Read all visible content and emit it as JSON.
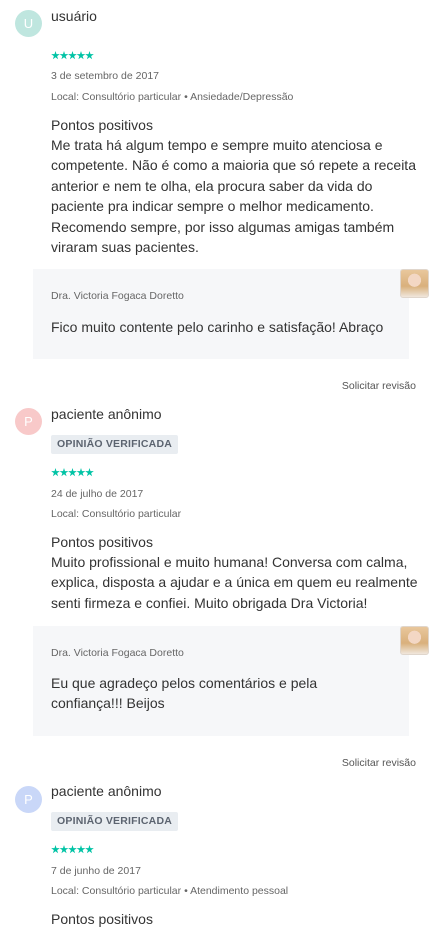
{
  "reviews": [
    {
      "avatar_letter": "U",
      "avatar_color": "#bfe6df",
      "name": "usuário",
      "badge": "",
      "date": "3 de setembro de 2017",
      "local": "Local: Consultório particular • Ansiedade/Depressão",
      "heading": "Pontos positivos",
      "text": "Me trata há algum tempo e sempre muito atenciosa e competente. Não é como a maioria que só repete a receita anterior e nem te olha, ela procura saber da vida do paciente pra indicar sempre o melhor medicamento. Recomendo sempre, por isso algumas amigas também viraram suas pacientes.",
      "reply_author": "Dra. Victoria Fogaca Doretto",
      "reply_text": "Fico muito contente pelo carinho e satisfação! Abraço",
      "request_review": "Solicitar revisão"
    },
    {
      "avatar_letter": "P",
      "avatar_color": "#f8c9c9",
      "name": "paciente anônimo",
      "badge": "OPINIÃO VERIFICADA",
      "date": "24 de julho de 2017",
      "local": "Local: Consultório particular",
      "heading": "Pontos positivos",
      "text": "Muito profissional e muito humana! Conversa com calma, explica, disposta a ajudar e a única em quem eu realmente senti firmeza e confiei. Muito obrigada Dra Victoria!",
      "reply_author": "Dra. Victoria Fogaca Doretto",
      "reply_text": "Eu que agradeço pelos comentários e pela confiança!!! Beijos",
      "request_review": "Solicitar revisão"
    },
    {
      "avatar_letter": "P",
      "avatar_color": "#c9d7f8",
      "name": "paciente anônimo",
      "badge": "OPINIÃO VERIFICADA",
      "date": "7 de junho de 2017",
      "local": "Local: Consultório particular • Atendimento pessoal",
      "heading": "Pontos positivos"
    }
  ],
  "rating": {
    "stars": 5,
    "max": 5
  },
  "colors": {
    "star": "#00c3a5",
    "badge_bg": "#e9edf1",
    "reply_bg": "#f6f7f9"
  }
}
